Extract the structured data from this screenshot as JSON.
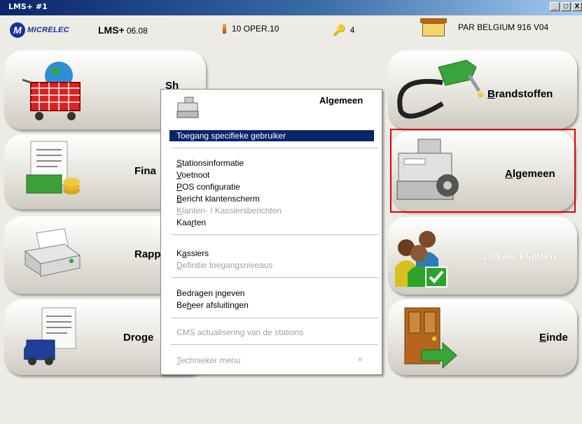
{
  "window": {
    "title": "LMS+ #1",
    "buttons": [
      "_",
      "□",
      "X"
    ]
  },
  "header": {
    "logo_letter": "M",
    "logo_text": "MICRELEC",
    "app_name": "LMS+",
    "app_version": "06.08",
    "operator": "10  OPER.10",
    "keys_count": "4",
    "station": "PAR BELGIUM 916 V04"
  },
  "tiles": {
    "shop": {
      "label": "Sh"
    },
    "financial": {
      "label": "Fina"
    },
    "reports": {
      "label": "Rapp"
    },
    "dry": {
      "label": "Droge"
    },
    "fuels": {
      "label_u": "B",
      "label_rest": "randstoffen"
    },
    "general": {
      "label_u": "A",
      "label_rest": "lgemeen"
    },
    "local_customers": {
      "label": "Lokale klanten"
    },
    "end": {
      "label_u": "E",
      "label_rest": "inde"
    }
  },
  "menu": {
    "title": "Algemeen",
    "items": {
      "specific_user": "Toegang specifieke gebruiker",
      "station_info_u": "S",
      "station_info_rest": "tationsinformatie",
      "footnote_u": "V",
      "footnote_rest": "oetnoot",
      "pos_config_u": "P",
      "pos_config_rest": "OS configuratie",
      "customer_screen_u": "B",
      "customer_screen_rest": "ericht klantenscherm",
      "customer_messages_u": "K",
      "customer_messages_rest": "lanten- / Kassiersberichten",
      "cards_a": "Kaa",
      "cards_u": "r",
      "cards_b": "ten",
      "cashiers_a": "K",
      "cashiers_u": "a",
      "cashiers_b": "ssiers",
      "access_levels_u": "D",
      "access_levels_rest": "efinitie toegangsniveaus",
      "amounts_a": "Bedragen ",
      "amounts_u": "i",
      "amounts_b": "ngeven",
      "closings_a": "Be",
      "closings_u": "h",
      "closings_b": "eer afsluitingen",
      "cms_update": "CMS actualisering van de stations",
      "tech_u": "T",
      "tech_rest": "echnieker menu",
      "tech_arrow": "»"
    }
  },
  "colors": {
    "highlight": "#0a246a",
    "selection_border": "#e00000",
    "title_bar": "#0a246a"
  }
}
